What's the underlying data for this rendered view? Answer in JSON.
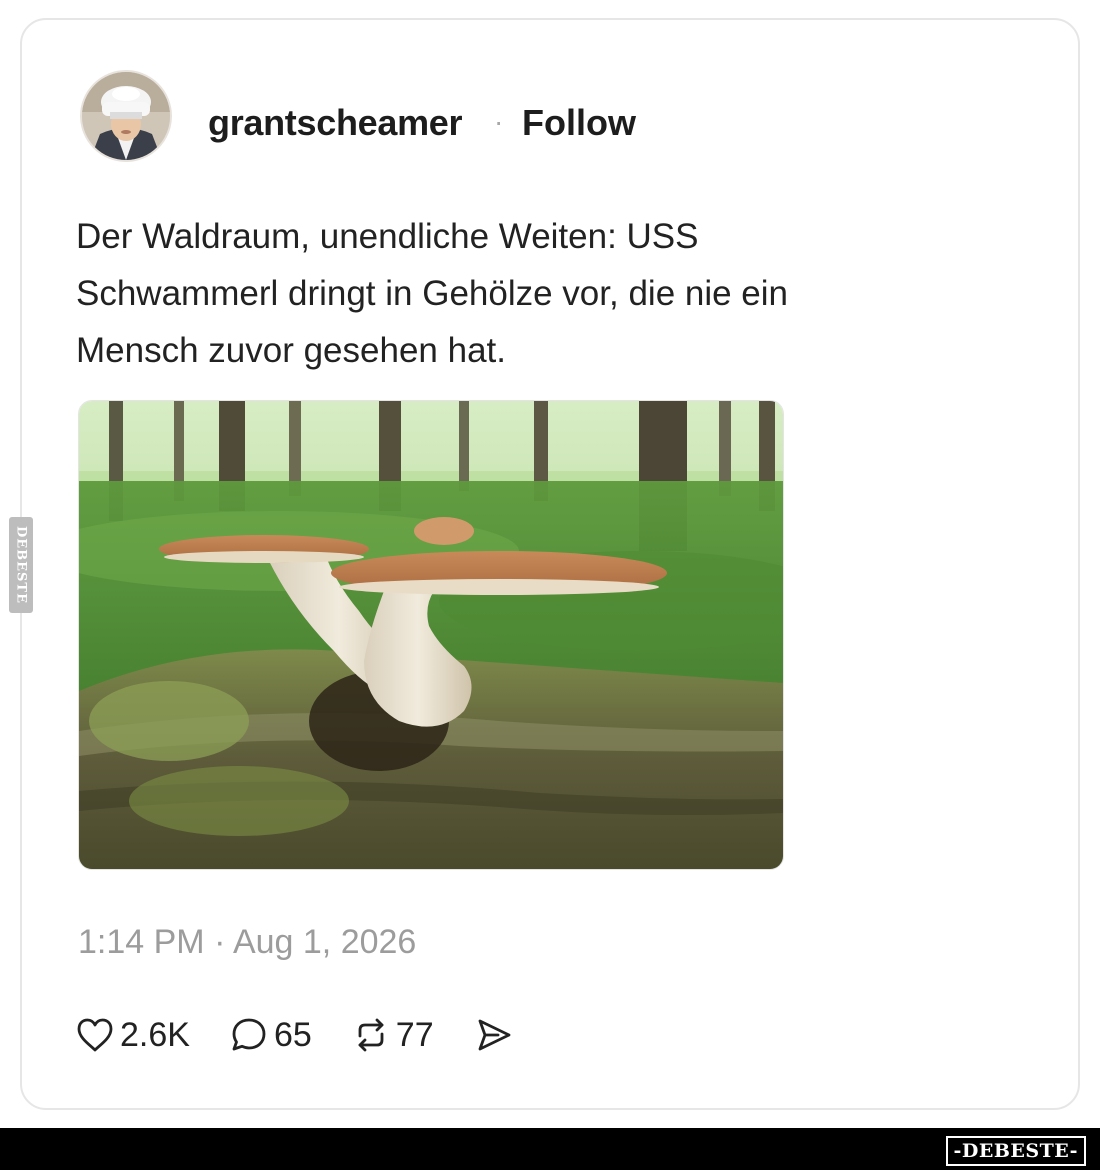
{
  "post": {
    "username": "grantscheamer",
    "separator": "·",
    "follow_label": "Follow",
    "text_lines": [
      "Der Waldraum, unendliche Weiten: USS",
      "Schwammerl dringt in Gehölze vor, die nie ein",
      "Mensch zuvor gesehen hat."
    ],
    "timestamp": "1:14 PM · Aug 1, 2026",
    "actions": {
      "likes": "2.6K",
      "replies": "65",
      "reposts": "77"
    },
    "icons": {
      "like": "heart-icon",
      "reply": "comment-bubble-icon",
      "repost": "repost-arrows-icon",
      "share": "send-icon"
    }
  },
  "watermark": {
    "side": "DEBESTE",
    "footer": "-DEBESTE-"
  },
  "colors": {
    "text": "#222222",
    "muted": "#9c9c9c",
    "card_border": "#e6e6e6",
    "footer_bar": "#000000"
  }
}
